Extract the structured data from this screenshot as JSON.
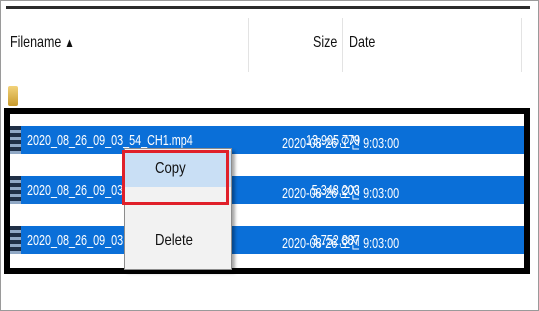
{
  "columns": {
    "filename": "Filename",
    "size": "Size",
    "date": "Date",
    "sort_indicator": "▲"
  },
  "rows": [
    {
      "name": "2020_08_26_09_03_54_CH1.mp4",
      "size": "13,905,779",
      "date": "2020-08-26 오전 9:03:00"
    },
    {
      "name": "2020_08_26_09_03",
      "size": "5,348,203",
      "date": "2020-08-26 오전 9:03:00"
    },
    {
      "name": "2020_08_26_09_03",
      "size": "3,752,887",
      "date": "2020-08-26 오전 9:03:00"
    }
  ],
  "context_menu": {
    "copy": "Copy",
    "delete": "Delete"
  },
  "colors": {
    "selection": "#0a6fd8",
    "highlight": "#e0202a",
    "annotation_box": "#000000"
  },
  "icons": {
    "folder": "folder-icon",
    "file": "video-file-icon"
  }
}
